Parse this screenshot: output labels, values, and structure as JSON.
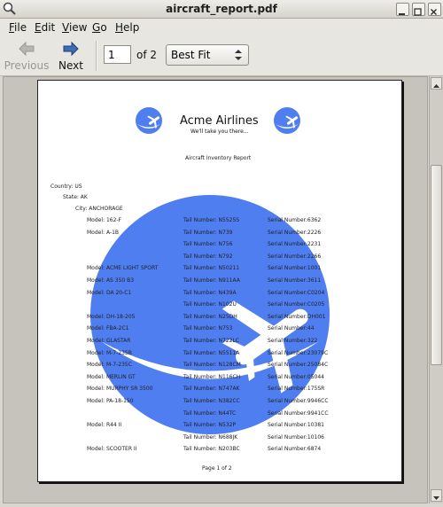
{
  "window": {
    "title": "aircraft_report.pdf"
  },
  "menu": [
    {
      "label": "File"
    },
    {
      "label": "Edit"
    },
    {
      "label": "View"
    },
    {
      "label": "Go"
    },
    {
      "label": "Help"
    }
  ],
  "toolbar": {
    "previous_label": "Previous",
    "next_label": "Next",
    "page_value": "1",
    "page_total": "of 2",
    "zoom_value": "Best Fit"
  },
  "document": {
    "company": "Acme Airlines",
    "tagline": "We'll take you there...",
    "report_title": "Aircraft Inventory Report",
    "country": "Country: US",
    "state": "State: AK",
    "city": "City: ANCHORAGE",
    "rows": [
      {
        "model": "Model: 162-F",
        "tail": "Tail Number: N5525S",
        "serial": "Serial Number:6362"
      },
      {
        "model": "Model: A-1B",
        "tail": "Tail Number: N739",
        "serial": "Serial Number:2226"
      },
      {
        "model": "",
        "tail": "Tail Number: N756",
        "serial": "Serial Number:2231"
      },
      {
        "model": "",
        "tail": "Tail Number: N792",
        "serial": "Serial Number:2266"
      },
      {
        "model": "Model: ACME LIGHT SPORT",
        "tail": "Tail Number: N50211",
        "serial": "Serial Number:1001"
      },
      {
        "model": "Model: AS 350 B3",
        "tail": "Tail Number: N911AA",
        "serial": "Serial Number:3611"
      },
      {
        "model": "Model: DA 20-C1",
        "tail": "Tail Number: N439A",
        "serial": "Serial Number:C0204"
      },
      {
        "model": "",
        "tail": "Tail Number: N102U",
        "serial": "Serial Number:C0205"
      },
      {
        "model": "Model: DH-18-205",
        "tail": "Tail Number: N25DH",
        "serial": "Serial Number:DH001"
      },
      {
        "model": "Model: FBA-2C1",
        "tail": "Tail Number: N753",
        "serial": "Serial Number:44"
      },
      {
        "model": "Model: GLASTAR",
        "tail": "Tail Number: N722LC",
        "serial": "Serial Number:322"
      },
      {
        "model": "Model: M-7-235B",
        "tail": "Tail Number: N5511A",
        "serial": "Serial Number:23079C"
      },
      {
        "model": "Model: M-7-235C",
        "tail": "Tail Number: N128CM",
        "serial": "Serial Number:25084C"
      },
      {
        "model": "Model: MERLIN GT",
        "tail": "Tail Number: N116CH",
        "serial": "Serial Number:05044"
      },
      {
        "model": "Model: MURPHY SR 3500",
        "tail": "Tail Number: N747AK",
        "serial": "Serial Number:175SR"
      },
      {
        "model": "Model: PA-18-150",
        "tail": "Tail Number: N382CC",
        "serial": "Serial Number:9946CC"
      },
      {
        "model": "",
        "tail": "Tail Number: N44TC",
        "serial": "Serial Number:9941CC"
      },
      {
        "model": "Model: R44 II",
        "tail": "Tail Number: N532P",
        "serial": "Serial Number:10381"
      },
      {
        "model": "",
        "tail": "Tail Number: N688JK",
        "serial": "Serial Number:10106"
      },
      {
        "model": "Model: SCOOTER II",
        "tail": "Tail Number: N203BC",
        "serial": "Serial Number:6874"
      }
    ],
    "footer": "Page 1 of  2"
  },
  "colors": {
    "brand_blue": "#4f7ef0"
  },
  "icons": [
    "app-icon",
    "arrow-left-icon",
    "arrow-right-icon",
    "chevron-updown-icon",
    "airline-logo-icon"
  ]
}
